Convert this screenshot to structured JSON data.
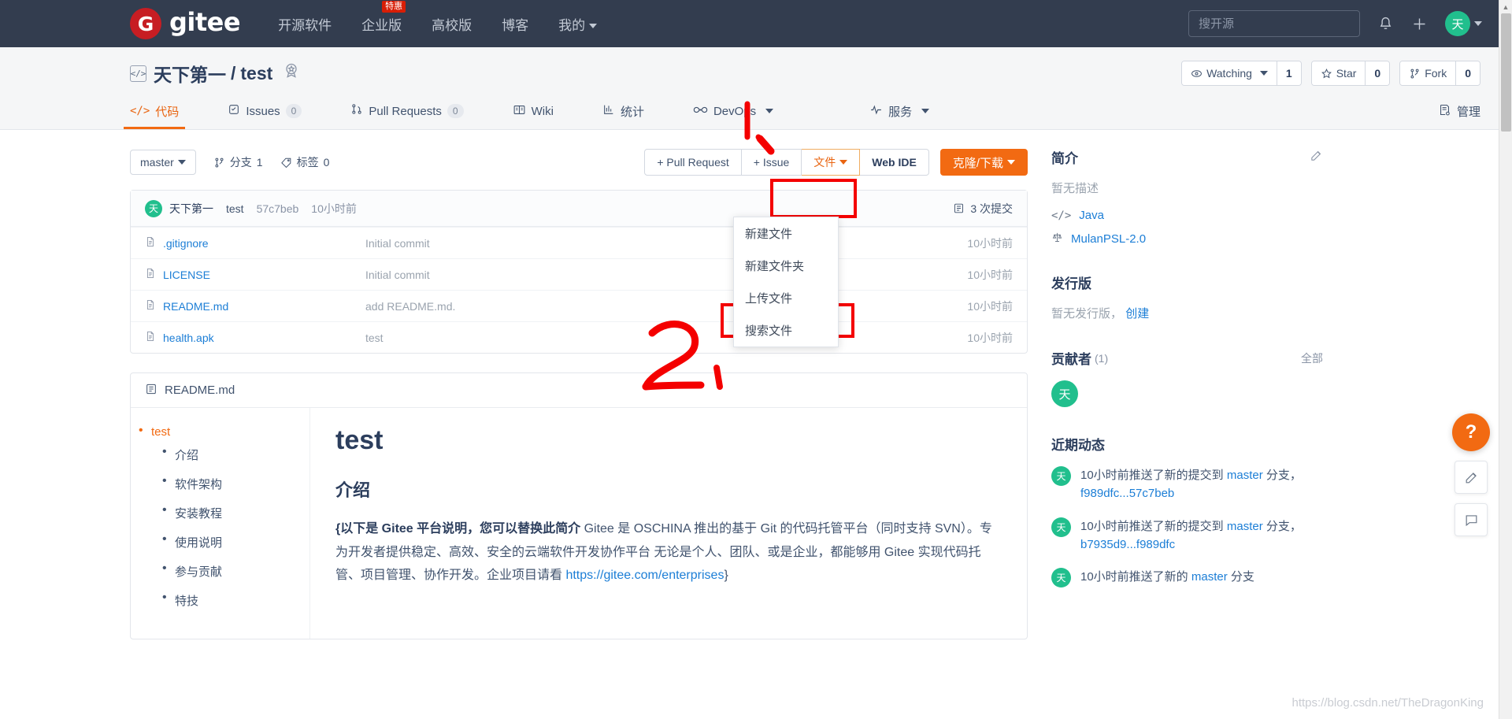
{
  "topnav": {
    "logo_text": "gitee",
    "logo_mark": "G",
    "links": [
      {
        "label": "开源软件",
        "badge": null,
        "caret": false
      },
      {
        "label": "企业版",
        "badge": "特惠",
        "caret": false
      },
      {
        "label": "高校版",
        "badge": null,
        "caret": false
      },
      {
        "label": "博客",
        "badge": null,
        "caret": false
      },
      {
        "label": "我的",
        "badge": null,
        "caret": true
      }
    ],
    "search_placeholder": "搜开源",
    "search_value": "",
    "bell_icon": "bell-icon",
    "plus_icon": "plus-icon",
    "avatar_text": "天"
  },
  "repo": {
    "code_icon": "</>",
    "owner": "天下第一",
    "separator": "/",
    "name": "test",
    "medal_icon": "medal-icon",
    "watch_label": "Watching",
    "watch_count": "1",
    "star_label": "Star",
    "star_count": "0",
    "fork_label": "Fork",
    "fork_count": "0"
  },
  "tabs": [
    {
      "label": "代码",
      "icon": "code-icon",
      "count": null,
      "active": true,
      "caret": false
    },
    {
      "label": "Issues",
      "icon": "issue-icon",
      "count": "0",
      "active": false,
      "caret": false
    },
    {
      "label": "Pull Requests",
      "icon": "pr-icon",
      "count": "0",
      "active": false,
      "caret": false
    },
    {
      "label": "Wiki",
      "icon": "wiki-icon",
      "count": null,
      "active": false,
      "caret": false
    },
    {
      "label": "统计",
      "icon": "chart-icon",
      "count": null,
      "active": false,
      "caret": false
    },
    {
      "label": "DevOps",
      "icon": "infinity-icon",
      "count": null,
      "active": false,
      "caret": true
    },
    {
      "label": "服务",
      "icon": "pulse-icon",
      "count": null,
      "active": false,
      "caret": true
    },
    {
      "label": "管理",
      "icon": "manage-icon",
      "count": null,
      "active": false,
      "caret": false
    }
  ],
  "toolbar": {
    "branch": "master",
    "branch_label": "分支",
    "branch_count": "1",
    "tag_label": "标签",
    "tag_count": "0",
    "pull_request_btn": "+ Pull Request",
    "issue_btn": "+ Issue",
    "files_btn": "文件",
    "webide_btn": "Web IDE",
    "clone_btn": "克隆/下载"
  },
  "files_dropdown": {
    "items": [
      {
        "label": "新建文件",
        "highlighted": false
      },
      {
        "label": "新建文件夹",
        "highlighted": false
      },
      {
        "label": "上传文件",
        "highlighted": true
      },
      {
        "label": "搜索文件",
        "highlighted": false
      }
    ]
  },
  "commit_bar": {
    "avatar_text": "天",
    "author": "天下第一",
    "message": "test",
    "sha": "57c7beb",
    "time": "10小时前",
    "commits_label": "3 次提交",
    "commits_icon": "history-icon"
  },
  "files": [
    {
      "name": ".gitignore",
      "message": "Initial commit",
      "time": "10小时前",
      "icon": "file-icon"
    },
    {
      "name": "LICENSE",
      "message": "Initial commit",
      "time": "10小时前",
      "icon": "file-icon"
    },
    {
      "name": "README.md",
      "message": "add README.md.",
      "time": "10小时前",
      "icon": "file-icon"
    },
    {
      "name": "health.apk",
      "message": "test",
      "time": "10小时前",
      "icon": "file-icon"
    }
  ],
  "readme": {
    "header": "README.md",
    "header_icon": "book-icon",
    "toc_root": "test",
    "toc_items": [
      "介绍",
      "软件架构",
      "安装教程",
      "使用说明",
      "参与贡献",
      "特技"
    ],
    "doc_title": "test",
    "doc_section": "介绍",
    "doc_bold": "{以下是 Gitee 平台说明，您可以替换此简介",
    "doc_body_1": " Gitee 是 OSCHINA 推出的基于 Git 的代码托管平台（同时支持 SVN）。专为开发者提供稳定、高效、安全的云端软件开发协作平台 无论是个人、团队、或是企业，都能够用 Gitee 实现代码托管、项目管理、协作开发。企业项目请看 ",
    "doc_link": "https://gitee.com/enterprises",
    "doc_body_2": "}"
  },
  "sidebar": {
    "intro_title": "简介",
    "intro_edit_icon": "edit-icon",
    "intro_empty": "暂无描述",
    "language": "Java",
    "language_icon": "code-icon",
    "license": "MulanPSL-2.0",
    "license_icon": "scale-icon",
    "release_title": "发行版",
    "release_empty": "暂无发行版，",
    "release_create": "创建",
    "contrib_title": "贡献者",
    "contrib_count": "(1)",
    "contrib_all": "全部",
    "contrib_avatar": "天",
    "activity_title": "近期动态",
    "activities": [
      {
        "avatar": "天",
        "prefix": "10小时前推送了新的提交到 ",
        "branch": "master",
        "suffix": " 分支，",
        "sha": "f989dfc...57c7beb"
      },
      {
        "avatar": "天",
        "prefix": "10小时前推送了新的提交到 ",
        "branch": "master",
        "suffix": " 分支，",
        "sha": "b7935d9...f989dfc"
      },
      {
        "avatar": "天",
        "prefix": "10小时前推送了新的 ",
        "branch": "master",
        "suffix": " 分支",
        "sha": ""
      }
    ]
  },
  "fabs": {
    "help": "?",
    "feedback_icon": "pencil-square-icon",
    "chat_icon": "chat-icon"
  },
  "annotations": {
    "step1": "1、",
    "step2": "2、"
  },
  "watermark": "https://blog.csdn.net/TheDragonKing",
  "colors": {
    "nav_bg": "#333d4f",
    "accent": "#f26a12",
    "brand_red": "#c71d23",
    "link": "#1c7ed6",
    "avatar_green": "#21bf8d",
    "annotation_red": "#f40000"
  }
}
